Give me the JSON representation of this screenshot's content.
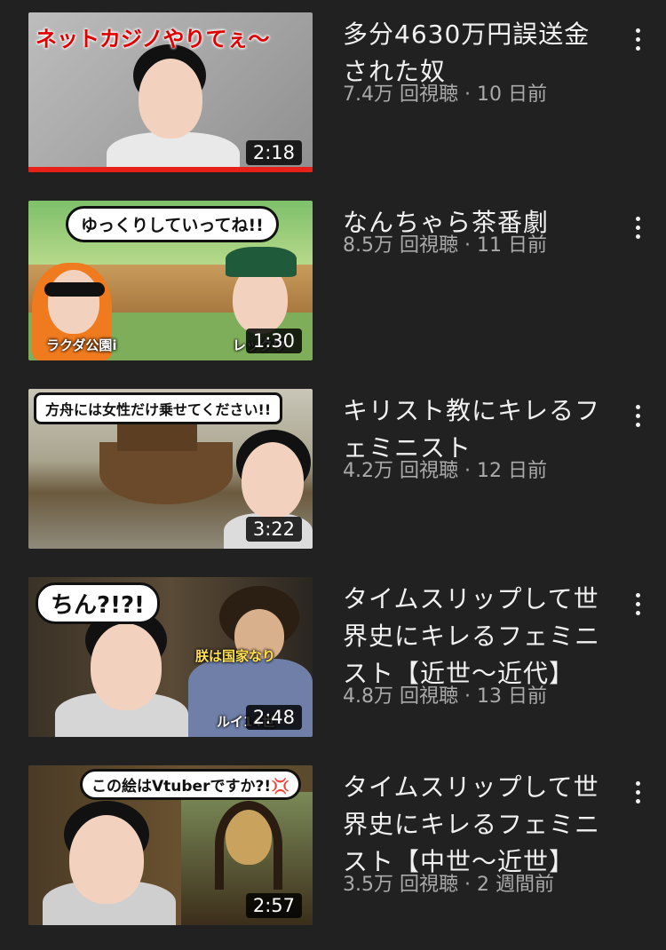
{
  "videos": [
    {
      "title": "多分4630万円誤送金された奴",
      "stats": "7.4万 回視聴 · 10 日前",
      "duration": "2:18",
      "thumbnail_text": "ネットカジノやりてぇ〜",
      "watched": 1.0
    },
    {
      "title": "なんちゃら茶番劇",
      "stats": "8.5万 回視聴 · 11 日前",
      "duration": "1:30",
      "thumbnail_text": "ゆっくりしていってね!!",
      "caption_left": "ラクダ公園i",
      "caption_right": "レックウ"
    },
    {
      "title": "キリスト教にキレるフェミニスト",
      "stats": "4.2万 回視聴 · 12 日前",
      "duration": "3:22",
      "thumbnail_text": "方舟には女性だけ乗せてください!!"
    },
    {
      "title": "タイムスリップして世界史にキレるフェミニスト【近世〜近代】",
      "stats": "4.8万 回視聴 · 13 日前",
      "duration": "2:48",
      "thumbnail_text": "ちん?!?!",
      "caption_right": "朕は国家なり",
      "caption_bottom": "ルイ14世"
    },
    {
      "title": "タイムスリップして世界史にキレるフェミニスト【中世〜近世】",
      "stats": "3.5万 回視聴 · 2 週間前",
      "duration": "2:57",
      "thumbnail_text": "この絵はVtuberですか?!💢"
    }
  ],
  "icons": {
    "more": "more-vert-icon"
  },
  "colors": {
    "background": "#212121",
    "progress": "#e62117",
    "title": "#f1f1f1",
    "stats": "#aaaaaa"
  }
}
